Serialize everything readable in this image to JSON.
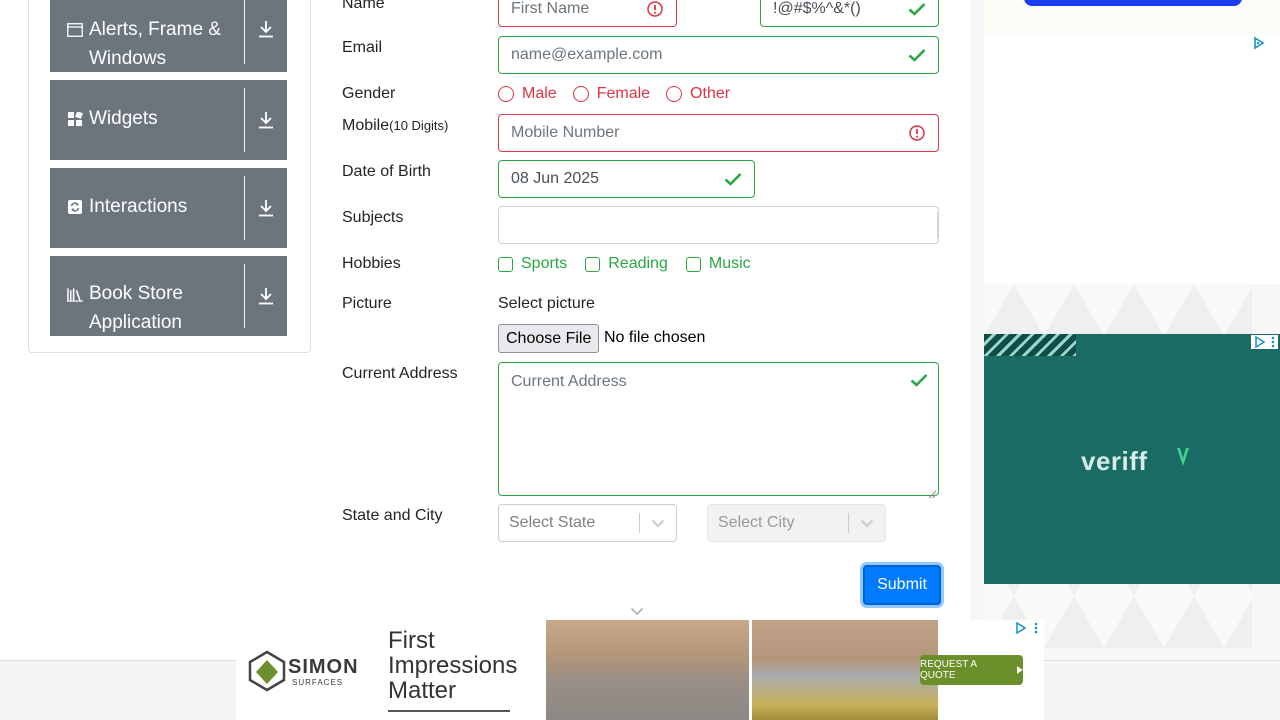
{
  "sidebar": {
    "groups": [
      {
        "label_line1": "Alerts, Frame &",
        "label_line2": "Windows",
        "icon": "window-icon"
      },
      {
        "label": "Widgets",
        "icon": "widgets-icon"
      },
      {
        "label": "Interactions",
        "icon": "interactions-icon"
      },
      {
        "label_line1": "Book Store",
        "label_line2": "Application",
        "icon": "books-icon"
      }
    ]
  },
  "form": {
    "name_label": "Name",
    "first_name_placeholder": "First Name",
    "last_name_value": "!@#$%^&*()",
    "email_label": "Email",
    "email_placeholder": "name@example.com",
    "gender_label": "Gender",
    "gender_options": [
      "Male",
      "Female",
      "Other"
    ],
    "mobile_label": "Mobile",
    "mobile_hint": "(10 Digits)",
    "mobile_placeholder": "Mobile Number",
    "dob_label": "Date of Birth",
    "dob_value": "08 Jun 2025",
    "subjects_label": "Subjects",
    "hobbies_label": "Hobbies",
    "hobbies_options": [
      "Sports",
      "Reading",
      "Music"
    ],
    "picture_label": "Picture",
    "select_picture_label": "Select picture",
    "choose_file_label": "Choose File",
    "no_file_text": "No file chosen",
    "address_label": "Current Address",
    "address_placeholder": "Current Address",
    "state_city_label": "State and City",
    "state_placeholder": "Select State",
    "city_placeholder": "Select City",
    "submit_label": "Submit"
  },
  "ads": {
    "veriff_brand": "veriff",
    "banner_brand": "SIMON",
    "banner_brand_sub": "SURFACES",
    "banner_headline_1": "First",
    "banner_headline_2": "Impressions",
    "banner_headline_3": "Matter",
    "banner_cta": "REQUEST A QUOTE"
  },
  "colors": {
    "invalid": "#dc3545",
    "valid": "#28a745",
    "primary": "#007bff",
    "sidebar_header": "#6c757d"
  }
}
